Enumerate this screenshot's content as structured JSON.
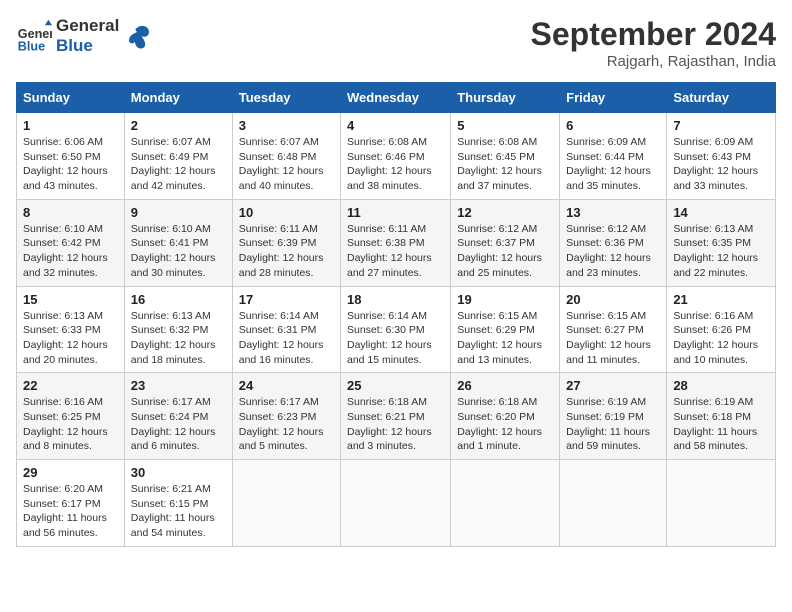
{
  "header": {
    "logo_line1": "General",
    "logo_line2": "Blue",
    "month_year": "September 2024",
    "location": "Rajgarh, Rajasthan, India"
  },
  "days_of_week": [
    "Sunday",
    "Monday",
    "Tuesday",
    "Wednesday",
    "Thursday",
    "Friday",
    "Saturday"
  ],
  "weeks": [
    [
      {
        "day": "1",
        "sunrise": "6:06 AM",
        "sunset": "6:50 PM",
        "daylight": "12 hours and 43 minutes."
      },
      {
        "day": "2",
        "sunrise": "6:07 AM",
        "sunset": "6:49 PM",
        "daylight": "12 hours and 42 minutes."
      },
      {
        "day": "3",
        "sunrise": "6:07 AM",
        "sunset": "6:48 PM",
        "daylight": "12 hours and 40 minutes."
      },
      {
        "day": "4",
        "sunrise": "6:08 AM",
        "sunset": "6:46 PM",
        "daylight": "12 hours and 38 minutes."
      },
      {
        "day": "5",
        "sunrise": "6:08 AM",
        "sunset": "6:45 PM",
        "daylight": "12 hours and 37 minutes."
      },
      {
        "day": "6",
        "sunrise": "6:09 AM",
        "sunset": "6:44 PM",
        "daylight": "12 hours and 35 minutes."
      },
      {
        "day": "7",
        "sunrise": "6:09 AM",
        "sunset": "6:43 PM",
        "daylight": "12 hours and 33 minutes."
      }
    ],
    [
      {
        "day": "8",
        "sunrise": "6:10 AM",
        "sunset": "6:42 PM",
        "daylight": "12 hours and 32 minutes."
      },
      {
        "day": "9",
        "sunrise": "6:10 AM",
        "sunset": "6:41 PM",
        "daylight": "12 hours and 30 minutes."
      },
      {
        "day": "10",
        "sunrise": "6:11 AM",
        "sunset": "6:39 PM",
        "daylight": "12 hours and 28 minutes."
      },
      {
        "day": "11",
        "sunrise": "6:11 AM",
        "sunset": "6:38 PM",
        "daylight": "12 hours and 27 minutes."
      },
      {
        "day": "12",
        "sunrise": "6:12 AM",
        "sunset": "6:37 PM",
        "daylight": "12 hours and 25 minutes."
      },
      {
        "day": "13",
        "sunrise": "6:12 AM",
        "sunset": "6:36 PM",
        "daylight": "12 hours and 23 minutes."
      },
      {
        "day": "14",
        "sunrise": "6:13 AM",
        "sunset": "6:35 PM",
        "daylight": "12 hours and 22 minutes."
      }
    ],
    [
      {
        "day": "15",
        "sunrise": "6:13 AM",
        "sunset": "6:33 PM",
        "daylight": "12 hours and 20 minutes."
      },
      {
        "day": "16",
        "sunrise": "6:13 AM",
        "sunset": "6:32 PM",
        "daylight": "12 hours and 18 minutes."
      },
      {
        "day": "17",
        "sunrise": "6:14 AM",
        "sunset": "6:31 PM",
        "daylight": "12 hours and 16 minutes."
      },
      {
        "day": "18",
        "sunrise": "6:14 AM",
        "sunset": "6:30 PM",
        "daylight": "12 hours and 15 minutes."
      },
      {
        "day": "19",
        "sunrise": "6:15 AM",
        "sunset": "6:29 PM",
        "daylight": "12 hours and 13 minutes."
      },
      {
        "day": "20",
        "sunrise": "6:15 AM",
        "sunset": "6:27 PM",
        "daylight": "12 hours and 11 minutes."
      },
      {
        "day": "21",
        "sunrise": "6:16 AM",
        "sunset": "6:26 PM",
        "daylight": "12 hours and 10 minutes."
      }
    ],
    [
      {
        "day": "22",
        "sunrise": "6:16 AM",
        "sunset": "6:25 PM",
        "daylight": "12 hours and 8 minutes."
      },
      {
        "day": "23",
        "sunrise": "6:17 AM",
        "sunset": "6:24 PM",
        "daylight": "12 hours and 6 minutes."
      },
      {
        "day": "24",
        "sunrise": "6:17 AM",
        "sunset": "6:23 PM",
        "daylight": "12 hours and 5 minutes."
      },
      {
        "day": "25",
        "sunrise": "6:18 AM",
        "sunset": "6:21 PM",
        "daylight": "12 hours and 3 minutes."
      },
      {
        "day": "26",
        "sunrise": "6:18 AM",
        "sunset": "6:20 PM",
        "daylight": "12 hours and 1 minute."
      },
      {
        "day": "27",
        "sunrise": "6:19 AM",
        "sunset": "6:19 PM",
        "daylight": "11 hours and 59 minutes."
      },
      {
        "day": "28",
        "sunrise": "6:19 AM",
        "sunset": "6:18 PM",
        "daylight": "11 hours and 58 minutes."
      }
    ],
    [
      {
        "day": "29",
        "sunrise": "6:20 AM",
        "sunset": "6:17 PM",
        "daylight": "11 hours and 56 minutes."
      },
      {
        "day": "30",
        "sunrise": "6:21 AM",
        "sunset": "6:15 PM",
        "daylight": "11 hours and 54 minutes."
      },
      null,
      null,
      null,
      null,
      null
    ]
  ]
}
